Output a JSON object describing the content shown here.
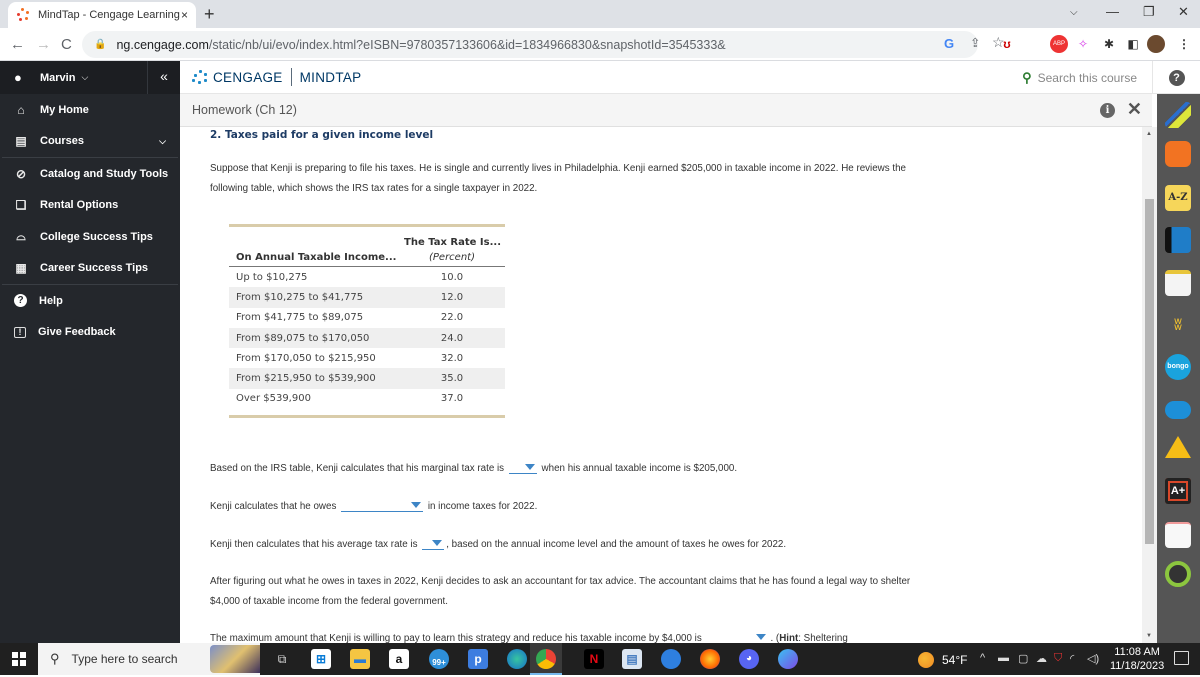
{
  "browser": {
    "tab_title": "MindTap - Cengage Learning",
    "tab_close": "×",
    "new_tab": "+",
    "url_host": "ng.cengage.com",
    "url_path": "/static/nb/ui/evo/index.html?eISBN=9780357133606&id=1834966830&snapshotId=3545333&",
    "window_controls": {
      "dropdown": "⌵",
      "minimize": "—",
      "maximize": "❐",
      "close": "✕"
    },
    "nav": {
      "back": "←",
      "forward": "→",
      "reload": "C"
    },
    "extensions": [
      "google-lens",
      "share",
      "bookmark-star",
      "ublock",
      "adblock-plus",
      "magic-wand",
      "extensions-puzzle",
      "side-panel",
      "profile-avatar",
      "menu"
    ]
  },
  "sidebar": {
    "user_name": "Marvin",
    "collapse_label": "«",
    "items": [
      {
        "label": "My Home",
        "icon": "home-icon",
        "glyph": "⌂"
      },
      {
        "label": "Courses",
        "icon": "book-icon",
        "glyph": "▤",
        "has_chevron": true
      },
      {
        "label": "Catalog and Study Tools",
        "icon": "compass-icon",
        "glyph": "⊘"
      },
      {
        "label": "Rental Options",
        "icon": "open-book-icon",
        "glyph": "❏"
      },
      {
        "label": "College Success Tips",
        "icon": "graduation-cap-icon",
        "glyph": "⌓"
      },
      {
        "label": "Career Success Tips",
        "icon": "briefcase-icon",
        "glyph": "▦"
      },
      {
        "label": "Help",
        "icon": "help-icon",
        "glyph": "?"
      },
      {
        "label": "Give Feedback",
        "icon": "feedback-icon",
        "glyph": "!"
      }
    ]
  },
  "header": {
    "brand": "CENGAGE",
    "product": "MINDTAP",
    "search_placeholder": "Search this course",
    "help": "?"
  },
  "activity": {
    "title": "Homework (Ch 12)",
    "info": "i",
    "close": "✕"
  },
  "question": {
    "title": "2. Taxes paid for a given income level",
    "intro": "Suppose that Kenji is preparing to file his taxes. He is single and currently lives in Philadelphia. Kenji earned $205,000 in taxable income in 2022. He reviews the following table, which shows the IRS tax rates for a single taxpayer in 2022.",
    "table": {
      "header_top": "The Tax Rate Is...",
      "col1": "On Annual Taxable Income...",
      "col2": "(Percent)",
      "rows": [
        {
          "income": "Up to $10,275",
          "rate": "10.0"
        },
        {
          "income": "From $10,275 to $41,775",
          "rate": "12.0"
        },
        {
          "income": "From $41,775 to $89,075",
          "rate": "22.0"
        },
        {
          "income": "From $89,075 to $170,050",
          "rate": "24.0"
        },
        {
          "income": "From $170,050 to $215,950",
          "rate": "32.0"
        },
        {
          "income": "From $215,950 to $539,900",
          "rate": "35.0"
        },
        {
          "income": "Over $539,900",
          "rate": "37.0"
        }
      ]
    },
    "q1_before": "Based on the IRS table, Kenji calculates that his marginal tax rate is",
    "q1_after": "when his annual taxable income is $205,000.",
    "q1_value": "",
    "q2_before": "Kenji calculates that he owes",
    "q2_after": "in income taxes for 2022.",
    "q2_value": "",
    "q3_before": "Kenji then calculates that his average tax rate is",
    "q3_after": ", based on the annual income level and the amount of taxes he owes for 2022.",
    "q3_value": "",
    "para4": "After figuring out what he owes in taxes in 2022, Kenji decides to ask an accountant for tax advice. The accountant claims that he has found a legal way to shelter $4,000 of taxable income from the federal government.",
    "q5_before": "The maximum amount that Kenji is willing to pay to learn this strategy and reduce his taxable income by $4,000 is",
    "q5_after": ". (",
    "q5_hint_label": "Hint",
    "q5_hint_text": ": Sheltering",
    "q5_value": ""
  },
  "apptray": [
    "highlighter-icon",
    "rss-icon",
    "glossary-az-icon",
    "book-icon",
    "notes-icon",
    "readspeaker-icon",
    "bongo-icon",
    "onedrive-icon",
    "google-drive-icon",
    "aplus-icon",
    "flashcards-icon",
    "progress-icon"
  ],
  "taskbar": {
    "search_placeholder": "Type here to search",
    "mail_badge": "99+",
    "temperature": "54°F",
    "time": "11:08 AM",
    "date": "11/18/2023"
  }
}
